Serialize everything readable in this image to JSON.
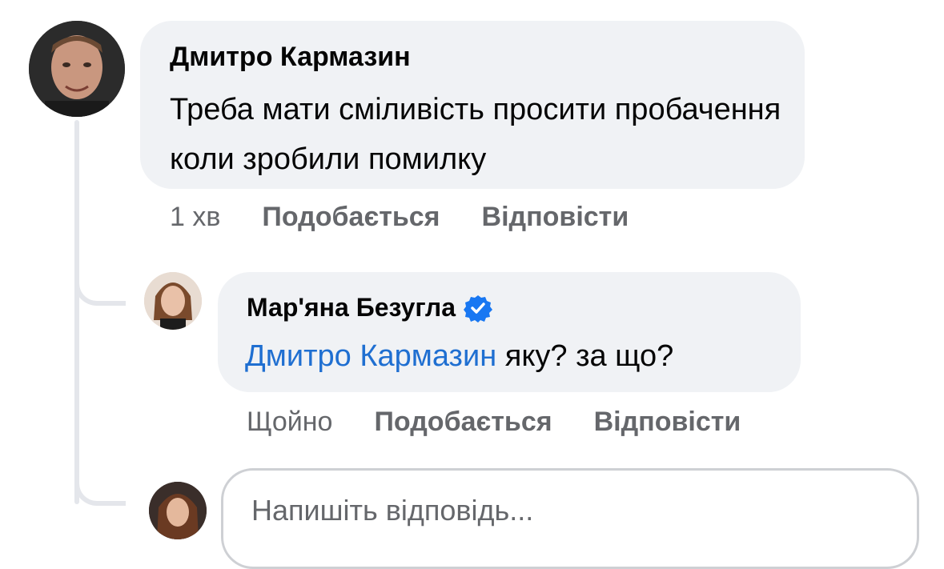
{
  "comment": {
    "author": "Дмитро Кармазин",
    "text": "Треба мати сміливість просити пробачення коли зробили помилку",
    "time": "1 хв",
    "like_label": "Подобається",
    "reply_label": "Відповісти"
  },
  "reply": {
    "author": "Мар'яна Безугла",
    "verified": true,
    "mention": "Дмитро Кармазин",
    "text": " яку? за що?",
    "time": "Щойно",
    "like_label": "Подобається",
    "reply_label": "Відповісти"
  },
  "composer": {
    "placeholder": "Напишіть відповідь..."
  },
  "colors": {
    "bubble": "#f0f2f5",
    "mention": "#1f6fd1",
    "verified": "#1877f2",
    "meta": "#65676b"
  }
}
